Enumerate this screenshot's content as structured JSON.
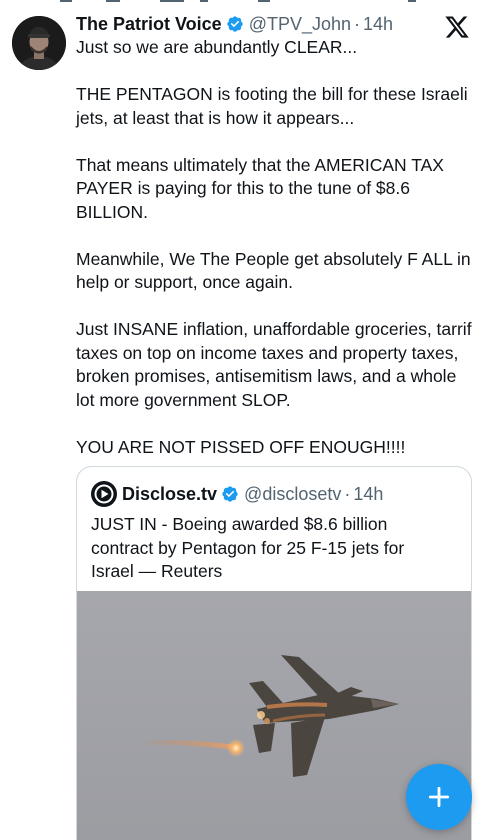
{
  "tweet": {
    "author": {
      "display_name": "The Patriot Voice",
      "verified": true,
      "handle": "@TPV_John",
      "time": "14h",
      "separator": "·"
    },
    "paragraphs": [
      "Just so we are abundantly CLEAR...",
      "THE PENTAGON is footing the bill for these Israeli jets, at least that is how it appears...",
      "That means ultimately that the AMERICAN TAX PAYER is paying for this to the tune of $8.6 BILLION.",
      "Meanwhile, We The People get absolutely F ALL in help or support, once again.",
      "Just INSANE inflation, unaffordable groceries, tarrif taxes on top on income taxes and property taxes, broken promises, antisemitism laws, and a whole lot more government SLOP.",
      "YOU ARE NOT PISSED OFF ENOUGH!!!!"
    ]
  },
  "quote": {
    "author": {
      "display_name": "Disclose.tv",
      "verified": true,
      "handle": "@disclosetv",
      "time": "14h",
      "separator": "·"
    },
    "text": "JUST IN - Boeing awarded $8.6 billion contract by Pentagon for 25 F-15 jets for Israel — Reuters"
  },
  "icons": {
    "verified": "verified-badge-icon",
    "brand": "x-logo-icon",
    "quote_avatar": "disclose-logo-icon",
    "compose": "plus-icon"
  },
  "colors": {
    "verified_blue": "#1d9bf0",
    "fab_blue": "#1d9bf0",
    "secondary_text": "#536471",
    "border": "#cfd9de",
    "sky": "#a3a4a9"
  }
}
